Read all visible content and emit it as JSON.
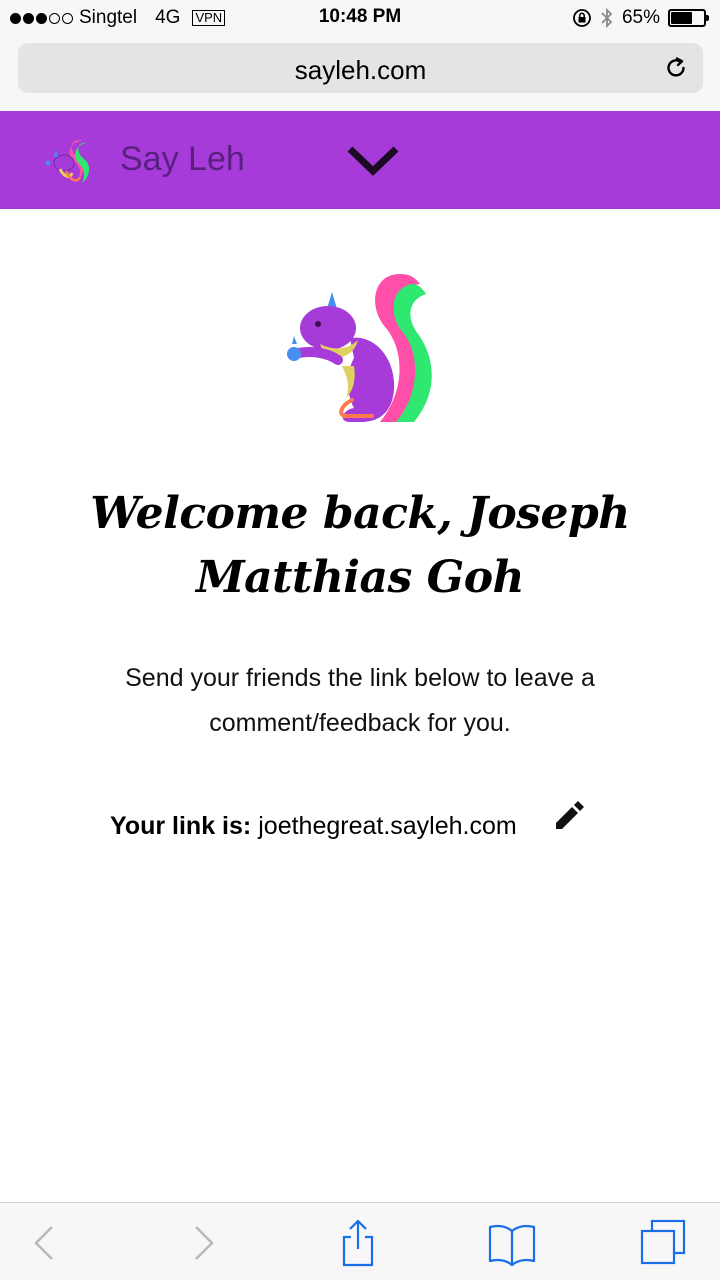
{
  "status_bar": {
    "carrier": "Singtel",
    "network": "4G",
    "vpn": "VPN",
    "time": "10:48 PM",
    "battery": "65%",
    "battery_level": 0.65,
    "signal_bars": 3
  },
  "url_bar": {
    "url": "sayleh.com"
  },
  "site_nav": {
    "brand": "Say Leh",
    "color": "#a63bd9"
  },
  "main": {
    "welcome": "Welcome back, Joseph Matthias Goh",
    "description": "Send your friends the link below to leave a comment/feedback for you.",
    "link_label": "Your link is:",
    "link_value": "joethegreat.sayleh.com"
  },
  "toolbar": {
    "accent": "#1a6ee8"
  }
}
